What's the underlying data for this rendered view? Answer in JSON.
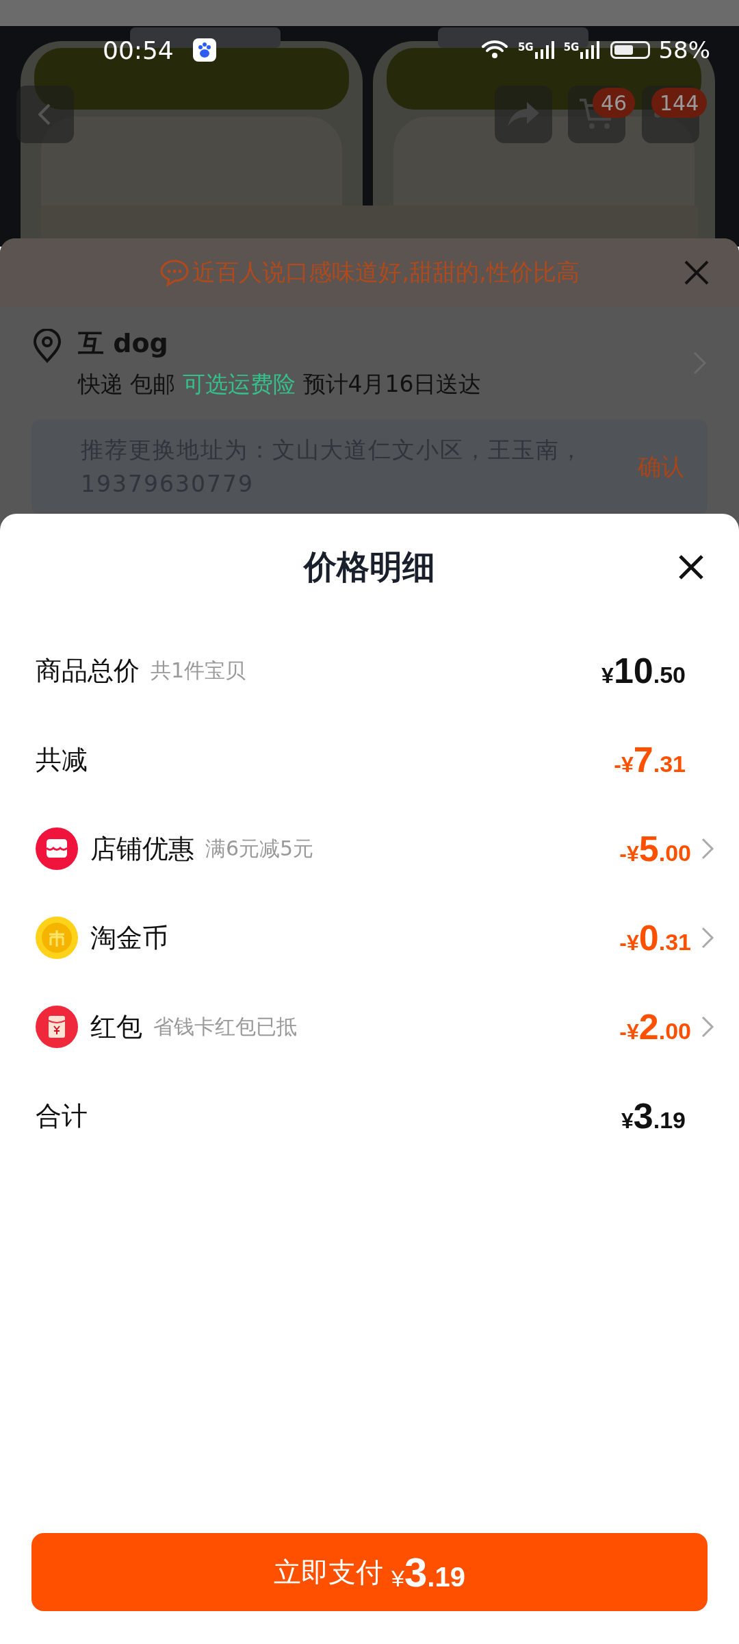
{
  "status_bar": {
    "time": "00:54",
    "networks": [
      {
        "label": "5G"
      },
      {
        "label": "5G"
      }
    ],
    "battery": "58%"
  },
  "product": {
    "kind": "picture",
    "cart_badge": "46",
    "more_badge": "144"
  },
  "order": {
    "tip": "近百人说口感味道好,甜甜的,性价比高",
    "address": {
      "name": "互 dog",
      "delivery": [
        {
          "text": "快递 包邮",
          "kind": "plain"
        },
        {
          "text": "可选运费险",
          "kind": "link"
        },
        {
          "text": "预计4月16日送达",
          "kind": "plain"
        }
      ]
    },
    "suggestion": {
      "text": "推荐更换地址为：文山大道仁文小区，王玉南，19379630779",
      "action": "确认"
    }
  },
  "price_sheet": {
    "title": "价格明细",
    "rows": [
      {
        "kind": "total",
        "label": "商品总价",
        "note": "共1件宝贝",
        "prefix": "¥",
        "integer": "10",
        "decimal": ".50",
        "discount": false
      },
      {
        "kind": "plain",
        "label": "共减",
        "prefix": "-¥",
        "integer": "7",
        "decimal": ".31",
        "discount": true
      },
      {
        "kind": "shop",
        "label": "店铺优惠",
        "note": "满6元减5元",
        "prefix": "-¥",
        "integer": "5",
        "decimal": ".00",
        "discount": true
      },
      {
        "kind": "coin",
        "label": "淘金币",
        "prefix": "-¥",
        "integer": "0",
        "decimal": ".31",
        "discount": true
      },
      {
        "kind": "redpacket",
        "label": "红包",
        "note": "省钱卡红包已抵",
        "prefix": "-¥",
        "integer": "2",
        "decimal": ".00",
        "discount": true
      },
      {
        "kind": "total",
        "label": "合计",
        "prefix": "¥",
        "integer": "3",
        "decimal": ".19",
        "discount": false
      }
    ]
  },
  "pay_button": {
    "label": "立即支付",
    "prefix": "¥",
    "integer": "3",
    "decimal": ".19"
  }
}
